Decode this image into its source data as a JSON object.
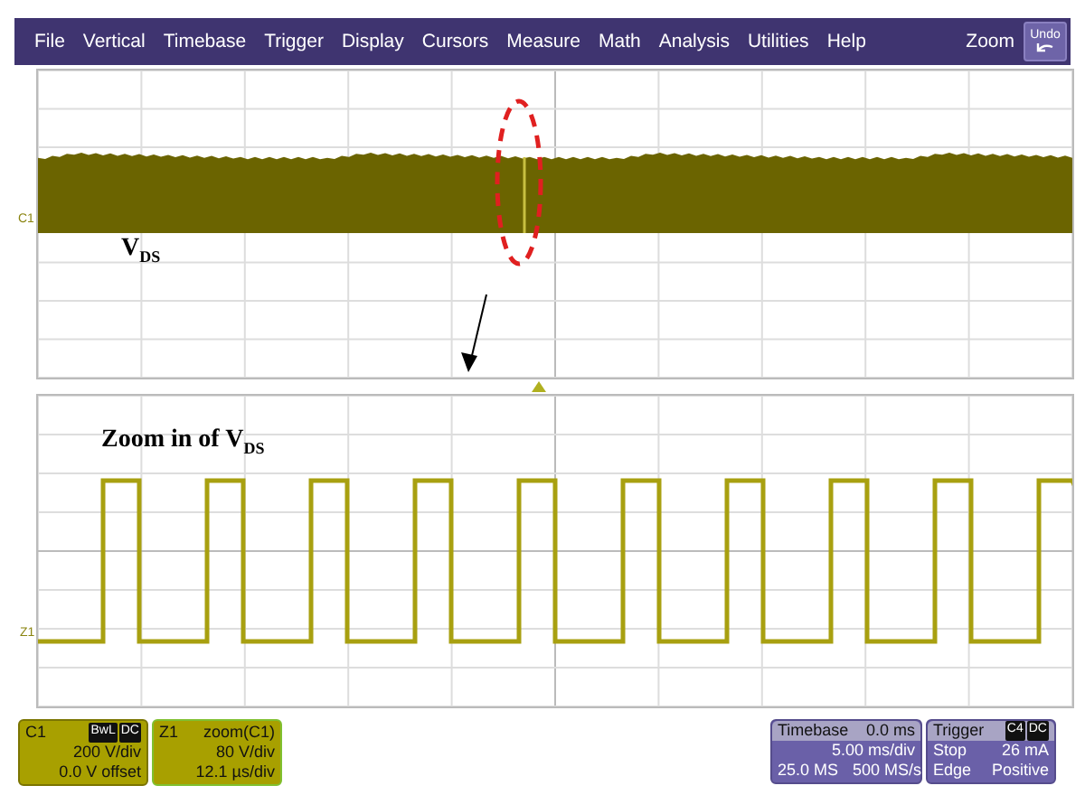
{
  "menu_bar": {
    "items": [
      "File",
      "Vertical",
      "Timebase",
      "Trigger",
      "Display",
      "Cursors",
      "Measure",
      "Math",
      "Analysis",
      "Utilities",
      "Help"
    ],
    "zoom_label": "Zoom",
    "undo_button": "Undo"
  },
  "main_grid": {
    "channel_marker": "C1",
    "annotation": "V$_{DS}$"
  },
  "zoom_grid": {
    "channel_marker": "Z1",
    "annotation": "Zoom in of V$_{DS}$"
  },
  "channel_c1": {
    "label": "C1",
    "tags": [
      "BwL",
      "DC"
    ],
    "scale": "200 V/div",
    "offset": "0.0 V offset"
  },
  "zoom_z1": {
    "label": "Z1",
    "source": "zoom(C1)",
    "scale": "80 V/div",
    "time_scale": "12.1 µs/div"
  },
  "timebase": {
    "label": "Timebase",
    "delay": "0.0 ms",
    "scale": "5.00 ms/div",
    "record": "25.0 MS",
    "rate": "500 MS/s"
  },
  "trigger": {
    "label": "Trigger",
    "tags": [
      "C4",
      "DC"
    ],
    "mode": "Stop",
    "threshold": "26 mA",
    "type": "Edge",
    "slope": "Positive"
  }
}
